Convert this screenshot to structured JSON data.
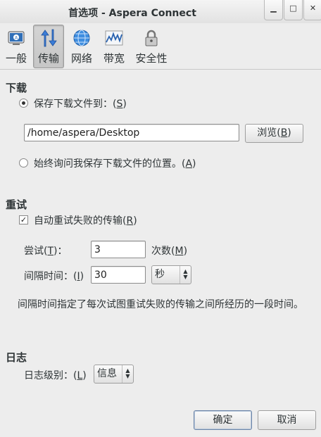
{
  "window": {
    "title": "首选项 - Aspera Connect"
  },
  "toolbar": {
    "items": [
      {
        "label": "一般"
      },
      {
        "label": "传输"
      },
      {
        "label": "网络"
      },
      {
        "label": "带宽"
      },
      {
        "label": "安全性"
      }
    ]
  },
  "download": {
    "section_title": "下载",
    "save_to_label": "保存下载文件到：(",
    "save_to_key": "S",
    "path_value": "/home/aspera/Desktop",
    "browse_label": "浏览(",
    "browse_key": "B",
    "ask_label": "始终询问我保存下载文件的位置。(",
    "ask_key": "A"
  },
  "retry": {
    "section_title": "重试",
    "auto_retry_label": "自动重试失败的传输(",
    "auto_retry_key": "R",
    "attempts_label": "尝试(",
    "attempts_key": "T",
    "attempts_value": "3",
    "attempts_unit": "次数(",
    "attempts_unit_key": "M",
    "interval_label": "间隔时间：(",
    "interval_key": "I",
    "interval_value": "30",
    "interval_unit": "秒",
    "description": "间隔时间指定了每次试图重试失败的传输之间所经历的一段时间。"
  },
  "log": {
    "section_title": "日志",
    "level_label": "日志级别：(",
    "level_key": "L",
    "level_value": "信息"
  },
  "buttons": {
    "ok": "确定",
    "cancel": "取消"
  }
}
